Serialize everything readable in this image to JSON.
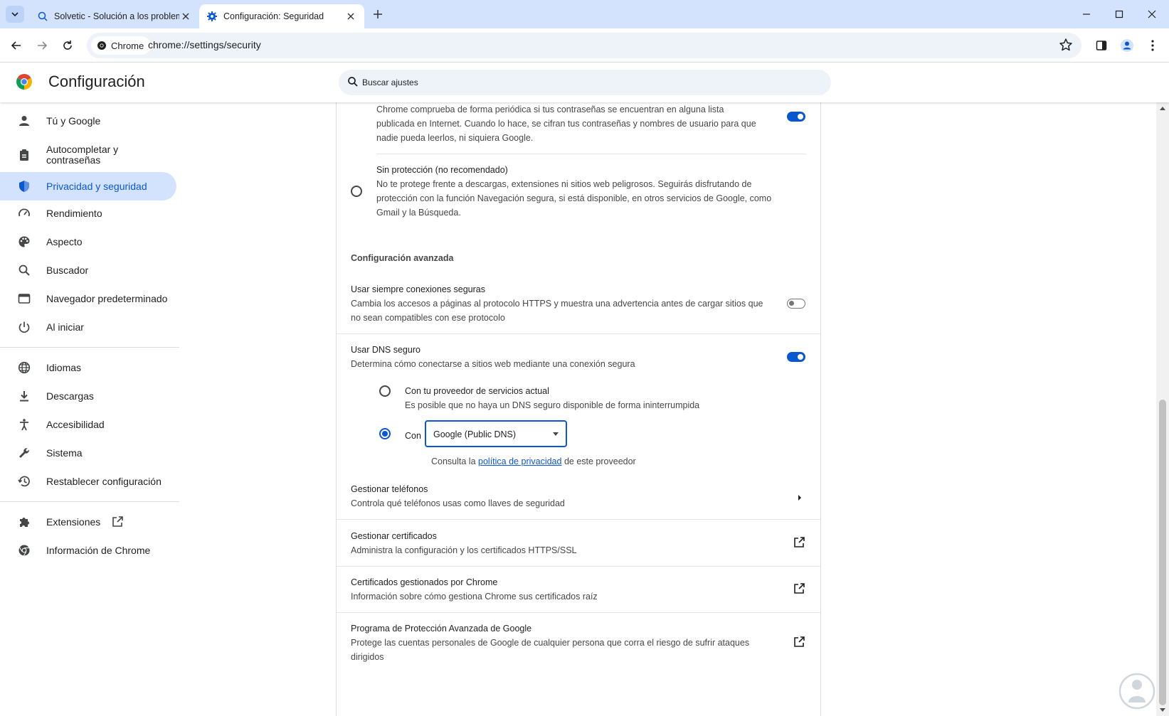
{
  "tabs": [
    {
      "title": "Solvetic - Solución a los problemas",
      "icon": "search-icon"
    },
    {
      "title": "Configuración: Seguridad",
      "icon": "gear-icon"
    }
  ],
  "toolbar": {
    "chip_label": "Chrome",
    "url": "chrome://settings/security"
  },
  "header": {
    "title": "Configuración",
    "search_placeholder": "Buscar ajustes"
  },
  "sidebar": {
    "items": [
      {
        "label": "Tú y Google",
        "icon": "person-icon"
      },
      {
        "label": "Autocompletar y contraseñas",
        "icon": "clipboard-icon"
      },
      {
        "label": "Privacidad y seguridad",
        "icon": "shield-icon",
        "selected": true
      },
      {
        "label": "Rendimiento",
        "icon": "speedometer-icon"
      },
      {
        "label": "Aspecto",
        "icon": "palette-icon"
      },
      {
        "label": "Buscador",
        "icon": "search-icon"
      },
      {
        "label": "Navegador predeterminado",
        "icon": "browser-icon"
      },
      {
        "label": "Al iniciar",
        "icon": "power-icon"
      },
      {
        "label": "Idiomas",
        "icon": "globe-icon"
      },
      {
        "label": "Descargas",
        "icon": "download-icon"
      },
      {
        "label": "Accesibilidad",
        "icon": "accessibility-icon"
      },
      {
        "label": "Sistema",
        "icon": "wrench-icon"
      },
      {
        "label": "Restablecer configuración",
        "icon": "history-icon"
      },
      {
        "label": "Extensiones",
        "icon": "puzzle-icon"
      },
      {
        "label": "Información de Chrome",
        "icon": "chrome-icon"
      }
    ]
  },
  "main": {
    "standard_desc_line1": "Chrome comprueba de forma periódica si tus contraseñas se encuentran en alguna lista",
    "standard_desc_line2": "publicada en Internet. Cuando lo hace, se cifran tus contraseñas y nombres de usuario para que",
    "standard_desc_line3": "nadie pueda leerlos, ni siquiera Google.",
    "no_protection_title": "Sin protección (no recomendado)",
    "no_protection_desc_line1": "No te protege frente a descargas, extensiones ni sitios web peligrosos. Seguirás disfrutando de",
    "no_protection_desc_line2": "protección con la función Navegación segura, si está disponible, en otros servicios de Google, como",
    "no_protection_desc_line3": "Gmail y la Búsqueda.",
    "advanced_heading": "Configuración avanzada",
    "https_title": "Usar siempre conexiones seguras",
    "https_desc_line1": "Cambia los accesos a páginas al protocolo HTTPS y muestra una advertencia antes de cargar sitios que",
    "https_desc_line2": "no sean compatibles con ese protocolo",
    "dns_title": "Usar DNS seguro",
    "dns_desc": "Determina cómo conectarse a sitios web mediante una conexión segura",
    "dns_current_title": "Con tu proveedor de servicios actual",
    "dns_current_desc": "Es posible que no haya un DNS seguro disponible de forma ininterrumpida",
    "dns_custom_label": "Con",
    "dns_provider": "Google (Public DNS)",
    "privacy_prefix": "Consulta la",
    "privacy_link": "política de privacidad",
    "privacy_suffix": "de este proveedor",
    "phones_title": "Gestionar teléfonos",
    "phones_desc": "Controla qué teléfonos usas como llaves de seguridad",
    "certs_title": "Gestionar certificados",
    "certs_desc": "Administra la configuración y los certificados HTTPS/SSL",
    "chrome_certs_title": "Certificados gestionados por Chrome",
    "chrome_certs_desc": "Información sobre cómo gestiona Chrome sus certificados raíz",
    "app_title": "Programa de Protección Avanzada de Google",
    "app_desc_line1": "Protege las cuentas personales de Google de cualquier persona que corra el riesgo de sufrir ataques",
    "app_desc_line2": "dirigidos"
  },
  "state": {
    "password_check_toggle": true,
    "https_toggle": false,
    "dns_toggle": true,
    "dns_mode": "custom"
  },
  "colors": {
    "accent": "#0b57d0",
    "tabstrip": "#d3e3fd",
    "selected_nav": "#d3e3fd"
  }
}
